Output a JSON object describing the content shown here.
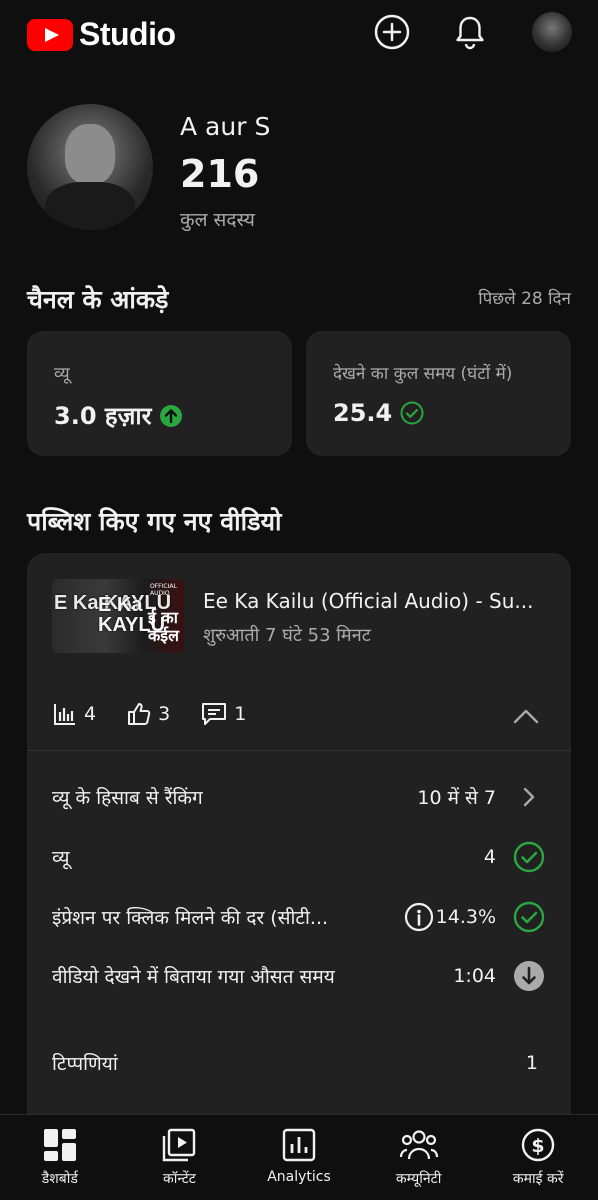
{
  "app": {
    "logo_text": "Studio"
  },
  "topbar": {
    "icons": [
      "create-icon",
      "notifications-icon"
    ]
  },
  "channel": {
    "name": "A aur S",
    "subscribers": "216",
    "subscribers_label": "कुल सदस्य"
  },
  "analytics": {
    "title": "चैनल के आंकड़े",
    "period": "पिछले 28 दिन",
    "views": {
      "label": "व्यू",
      "value": "3.0 हज़ार",
      "trend": "up"
    },
    "watch_time": {
      "label": "देखने का कुल समय (घंटों में)",
      "value": "25.4",
      "trend": "check"
    }
  },
  "published": {
    "title": "पब्लिश किए गए नए वीडियो",
    "video": {
      "title": "Ee Ka Kailu (Official Audio) - Su...",
      "subtitle": "शुरुआती 7 घंटे 53 मिनट",
      "thumbnail_text_1": "E Ka KAYLU",
      "thumbnail_text_2": "E Ka KAYLU",
      "thumbnail_text_3": "ई का कईल",
      "thumbnail_tag": "OFFICIAL AUDIO",
      "metrics": {
        "views": "4",
        "likes": "3",
        "comments": "1"
      },
      "rows": [
        {
          "label": "व्यू के हिसाब से रैंकिंग",
          "value": "10 में से 7",
          "icon": "chevron-right-icon"
        },
        {
          "label": "व्यू",
          "value": "4",
          "icon": "check-circle-icon"
        },
        {
          "label": "इंप्रेशन पर क्लिक मिलने की दर (सीटी...",
          "value": "14.3%",
          "icon": "check-circle-icon"
        },
        {
          "label": "वीडियो देखने में बिताया गया औसत समय",
          "value": "1:04",
          "icon": "arrow-down-circle-icon"
        }
      ],
      "comments_label": "टिप्पणियां",
      "comments_count": "1"
    }
  },
  "bottom_nav": [
    {
      "label": "डैशबोर्ड",
      "icon": "dashboard-icon"
    },
    {
      "label": "कॉन्टेंट",
      "icon": "content-icon"
    },
    {
      "label": "Analytics",
      "icon": "analytics-icon"
    },
    {
      "label": "कम्यूनिटी",
      "icon": "community-icon"
    },
    {
      "label": "कमाई करें",
      "icon": "earn-icon"
    }
  ],
  "colors": {
    "background": "#0f0f0f",
    "card": "#212121",
    "brand_red": "#ff0000",
    "success_green": "#2ba640",
    "muted_text": "#aaaaaa"
  }
}
